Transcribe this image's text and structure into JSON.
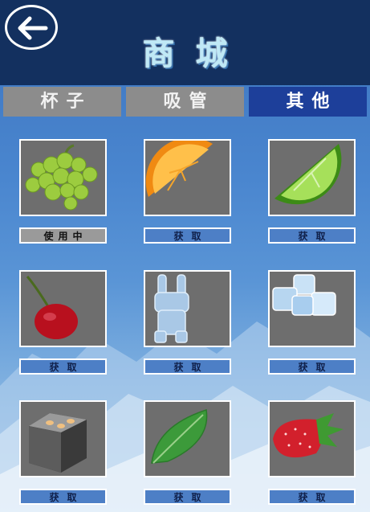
{
  "header": {
    "title": "商城"
  },
  "tabs": [
    {
      "label": "杯子",
      "active": false
    },
    {
      "label": "吸管",
      "active": false
    },
    {
      "label": "其他",
      "active": true
    }
  ],
  "items": [
    {
      "icon": "grapes-icon",
      "button": "使用中",
      "state": "in-use"
    },
    {
      "icon": "orange-slice-icon",
      "button": "获取",
      "state": "available"
    },
    {
      "icon": "lime-slice-icon",
      "button": "获取",
      "state": "available"
    },
    {
      "icon": "cherry-icon",
      "button": "获取",
      "state": "available"
    },
    {
      "icon": "ice-rabbit-icon",
      "button": "获取",
      "state": "available"
    },
    {
      "icon": "ice-cubes-icon",
      "button": "获取",
      "state": "available"
    },
    {
      "icon": "steel-ice-cube-icon",
      "button": "获取",
      "state": "available"
    },
    {
      "icon": "mint-leaf-icon",
      "button": "获取",
      "state": "available"
    },
    {
      "icon": "strawberry-icon",
      "button": "获取",
      "state": "available"
    }
  ]
}
